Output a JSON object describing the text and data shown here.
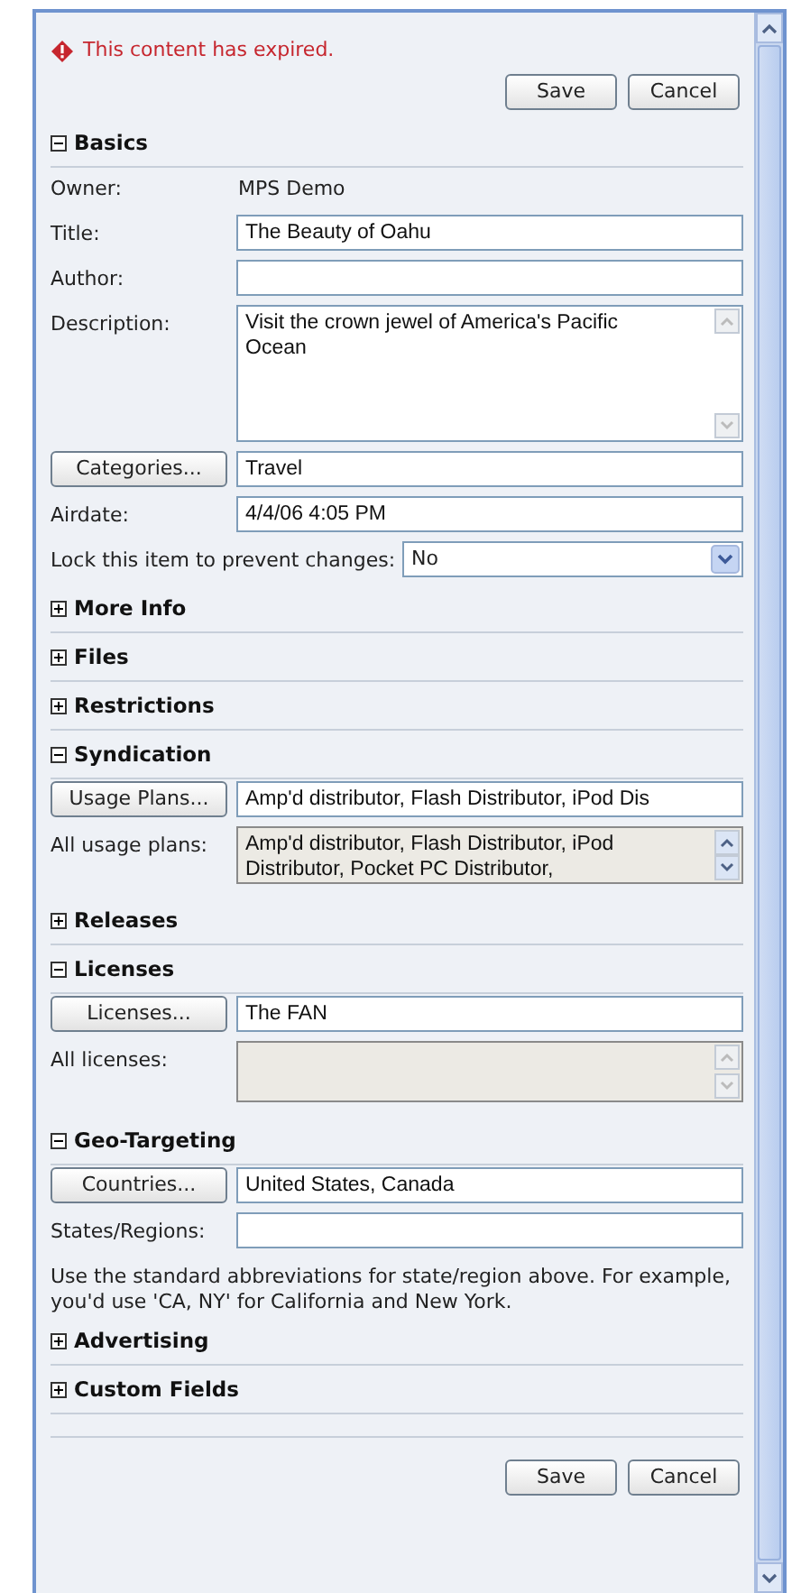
{
  "alert": {
    "text": "This content has expired."
  },
  "top_buttons": [
    "Save",
    "Cancel"
  ],
  "sections": [
    {
      "title": "Basics",
      "expanded": true,
      "fields": [
        {
          "kind": "static",
          "label": "Owner:",
          "value": "MPS Demo"
        },
        {
          "kind": "text",
          "label": "Title:",
          "value": "The Beauty of Oahu"
        },
        {
          "kind": "text",
          "label": "Author:"
        },
        {
          "kind": "textarea",
          "label": "Description:",
          "value": "Visit the crown jewel of America's Pacific Ocean"
        },
        {
          "kind": "picker",
          "button": "Categories...",
          "value": "Travel"
        },
        {
          "kind": "text",
          "label": "Airdate:",
          "value": "4/4/06 4:05 PM"
        },
        {
          "kind": "select",
          "label": "Lock this item to prevent changes:",
          "value": "No"
        }
      ]
    },
    {
      "title": "More Info",
      "expanded": false
    },
    {
      "title": "Files",
      "expanded": false
    },
    {
      "title": "Restrictions",
      "expanded": false
    },
    {
      "title": "Syndication",
      "expanded": true,
      "fields": [
        {
          "kind": "picker",
          "button": "Usage Plans...",
          "value": "Amp'd distributor, Flash Distributor, iPod Dis"
        },
        {
          "kind": "readonly_area",
          "label": "All usage plans:",
          "value": "Amp'd distributor, Flash Distributor, iPod Distributor, Pocket PC Distributor,"
        }
      ]
    },
    {
      "title": "Releases",
      "expanded": false
    },
    {
      "title": "Licenses",
      "expanded": true,
      "fields": [
        {
          "kind": "picker",
          "button": "Licenses...",
          "value": "The FAN"
        },
        {
          "kind": "readonly_area",
          "label": "All licenses:"
        }
      ]
    },
    {
      "title": "Geo-Targeting",
      "expanded": true,
      "fields": [
        {
          "kind": "picker",
          "button": "Countries...",
          "value": "United States, Canada"
        },
        {
          "kind": "text",
          "label": "States/Regions:"
        },
        {
          "kind": "note",
          "text": "Use the standard abbreviations for state/region above. For example, you'd use 'CA, NY' for California and New York."
        }
      ]
    },
    {
      "title": "Advertising",
      "expanded": false
    },
    {
      "title": "Custom Fields",
      "expanded": false
    }
  ],
  "bottom_buttons": [
    "Save",
    "Cancel"
  ]
}
